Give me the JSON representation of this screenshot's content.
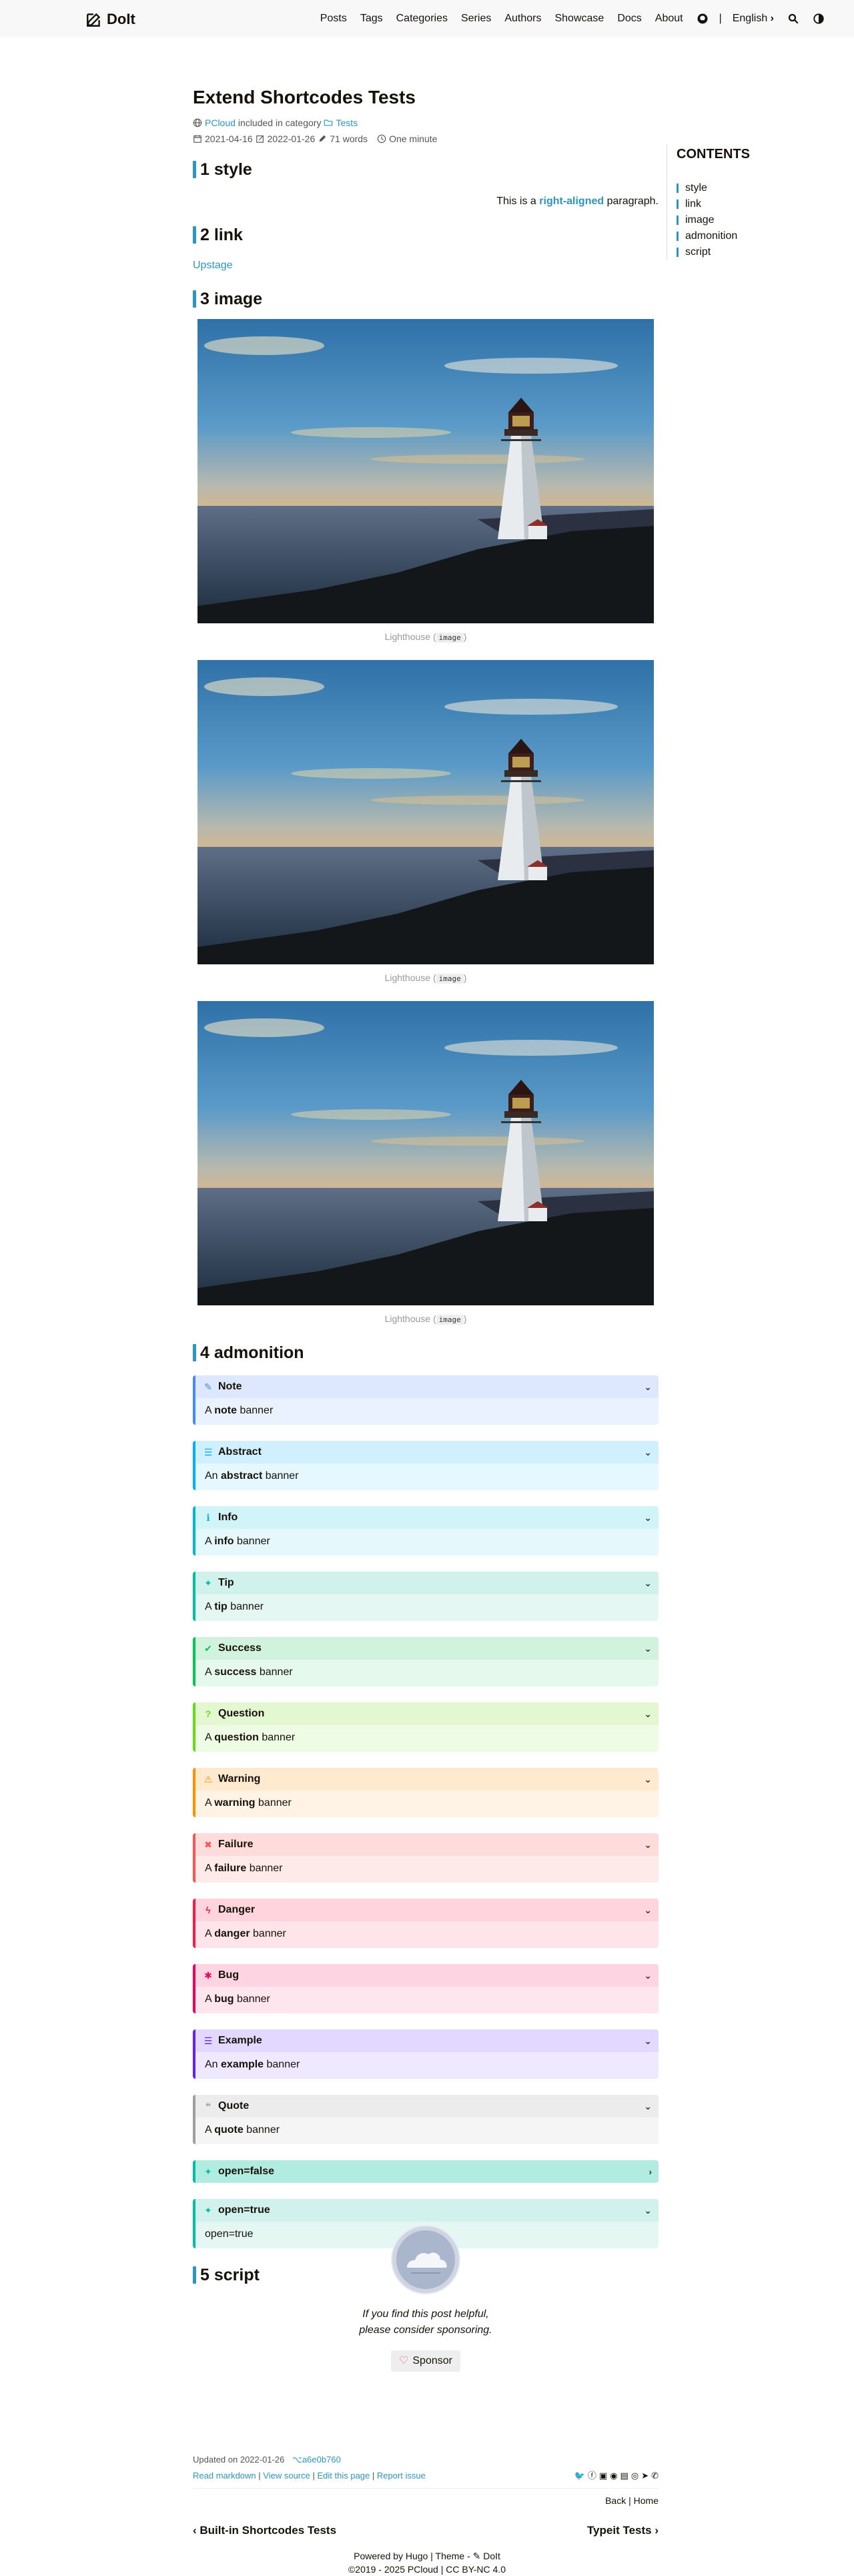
{
  "header": {
    "logo": "DoIt",
    "menu": [
      "Posts",
      "Tags",
      "Categories",
      "Series",
      "Authors",
      "Showcase",
      "Docs",
      "About"
    ],
    "separator": "|",
    "language": "English"
  },
  "post": {
    "title": "Extend Shortcodes Tests",
    "author": "PCloud",
    "included_text": "included in category",
    "category": "Tests",
    "published": "2021-04-16",
    "updated": "2022-01-26",
    "words": "71 words",
    "reading_time": "One minute"
  },
  "sections": {
    "style": {
      "heading": "1 style",
      "para_before": "This is a ",
      "para_highlight": "right-aligned",
      "para_after": " paragraph."
    },
    "link": {
      "heading": "2 link",
      "link_text": "Upstage"
    },
    "image": {
      "heading": "3 image",
      "caption": "Lighthouse (",
      "caption_code": "image",
      "caption_end": ")"
    },
    "admonition": {
      "heading": "4 admonition"
    },
    "script": {
      "heading": "5 script"
    }
  },
  "admonitions": [
    {
      "title": "Note",
      "icon": "✎",
      "pre": "A ",
      "bold": "note",
      "post": " banner",
      "open": true,
      "color": "#448aff",
      "head_bg": "#dde8ff",
      "body_bg": "#ebf2ff",
      "icon_color": "#448aff"
    },
    {
      "title": "Abstract",
      "icon": "☰",
      "pre": "An ",
      "bold": "abstract",
      "post": " banner",
      "open": true,
      "color": "#00b0ff",
      "head_bg": "#d1f0ff",
      "body_bg": "#e5f7ff",
      "icon_color": "#00b0ff"
    },
    {
      "title": "Info",
      "icon": "ℹ",
      "pre": "A ",
      "bold": "info",
      "post": " banner",
      "open": true,
      "color": "#00b8d4",
      "head_bg": "#d1f4f8",
      "body_bg": "#e5f8fb",
      "icon_color": "#00b8d4"
    },
    {
      "title": "Tip",
      "icon": "✦",
      "pre": "A ",
      "bold": "tip",
      "post": " banner",
      "open": true,
      "color": "#00bfa5",
      "head_bg": "#d1f2ec",
      "body_bg": "#e5f7f3",
      "icon_color": "#00bfa5"
    },
    {
      "title": "Success",
      "icon": "✔",
      "pre": "A ",
      "bold": "success",
      "post": " banner",
      "open": true,
      "color": "#00c853",
      "head_bg": "#d1f3dd",
      "body_bg": "#e5f9ec",
      "icon_color": "#00c853"
    },
    {
      "title": "Question",
      "icon": "?",
      "pre": "A ",
      "bold": "question",
      "post": " banner",
      "open": true,
      "color": "#64dd17",
      "head_bg": "#e3f7d1",
      "body_bg": "#eefbe5",
      "icon_color": "#64dd17"
    },
    {
      "title": "Warning",
      "icon": "⚠",
      "pre": "A ",
      "bold": "warning",
      "post": " banner",
      "open": true,
      "color": "#ff9100",
      "head_bg": "#ffe9cf",
      "body_bg": "#fff3e5",
      "icon_color": "#ff9100"
    },
    {
      "title": "Failure",
      "icon": "✖",
      "pre": "A ",
      "bold": "failure",
      "post": " banner",
      "open": true,
      "color": "#ff5252",
      "head_bg": "#ffdcdc",
      "body_bg": "#ffeaea",
      "icon_color": "#ff5252"
    },
    {
      "title": "Danger",
      "icon": "ϟ",
      "pre": "A ",
      "bold": "danger",
      "post": " banner",
      "open": true,
      "color": "#ff1744",
      "head_bg": "#ffd4dc",
      "body_bg": "#ffe5ea",
      "icon_color": "#ff1744"
    },
    {
      "title": "Bug",
      "icon": "✱",
      "pre": "A ",
      "bold": "bug",
      "post": " banner",
      "open": true,
      "color": "#f50057",
      "head_bg": "#fdd4e2",
      "body_bg": "#fee5ee",
      "icon_color": "#f50057"
    },
    {
      "title": "Example",
      "icon": "☰",
      "pre": "An ",
      "bold": "example",
      "post": " banner",
      "open": true,
      "color": "#651fff",
      "head_bg": "#e3d8ff",
      "body_bg": "#efe9ff",
      "icon_color": "#651fff"
    },
    {
      "title": "Quote",
      "icon": "❝",
      "pre": "A ",
      "bold": "quote",
      "post": " banner",
      "open": true,
      "color": "#9e9e9e",
      "head_bg": "#ececec",
      "body_bg": "#f5f5f5",
      "icon_color": "#9e9e9e"
    },
    {
      "title": "open=false",
      "icon": "✦",
      "pre": "",
      "bold": "",
      "post": "",
      "open": false,
      "color": "#00bfa5",
      "head_bg": "#b2ebdf",
      "body_bg": "#e5f7f3",
      "icon_color": "#00bfa5"
    },
    {
      "title": "open=true",
      "icon": "✦",
      "pre": "open=true",
      "bold": "",
      "post": "",
      "open": true,
      "color": "#00bfa5",
      "head_bg": "#d1f2ec",
      "body_bg": "#e5f7f3",
      "icon_color": "#00bfa5"
    }
  ],
  "toc": {
    "title": "CONTENTS",
    "items": [
      "style",
      "link",
      "image",
      "admonition",
      "script"
    ]
  },
  "sponsor": {
    "text": "If you find this post helpful, please consider sponsoring.",
    "button": "Sponsor"
  },
  "post_footer": {
    "updated_label": "Updated on 2022-01-26",
    "commit": "a6e0b760",
    "links": [
      "Read markdown",
      "View source",
      "Edit this page",
      "Report issue"
    ],
    "back": "Back",
    "home": "Home",
    "prev": "Built-in Shortcodes Tests",
    "next": "Typeit Tests"
  },
  "site_footer": {
    "powered": "Powered by Hugo | Theme - ",
    "theme": "DoIt",
    "copyright": "©2019 - 2025 PCloud | CC BY-NC 4.0"
  },
  "colors": {
    "accent": "#2d96bd"
  }
}
